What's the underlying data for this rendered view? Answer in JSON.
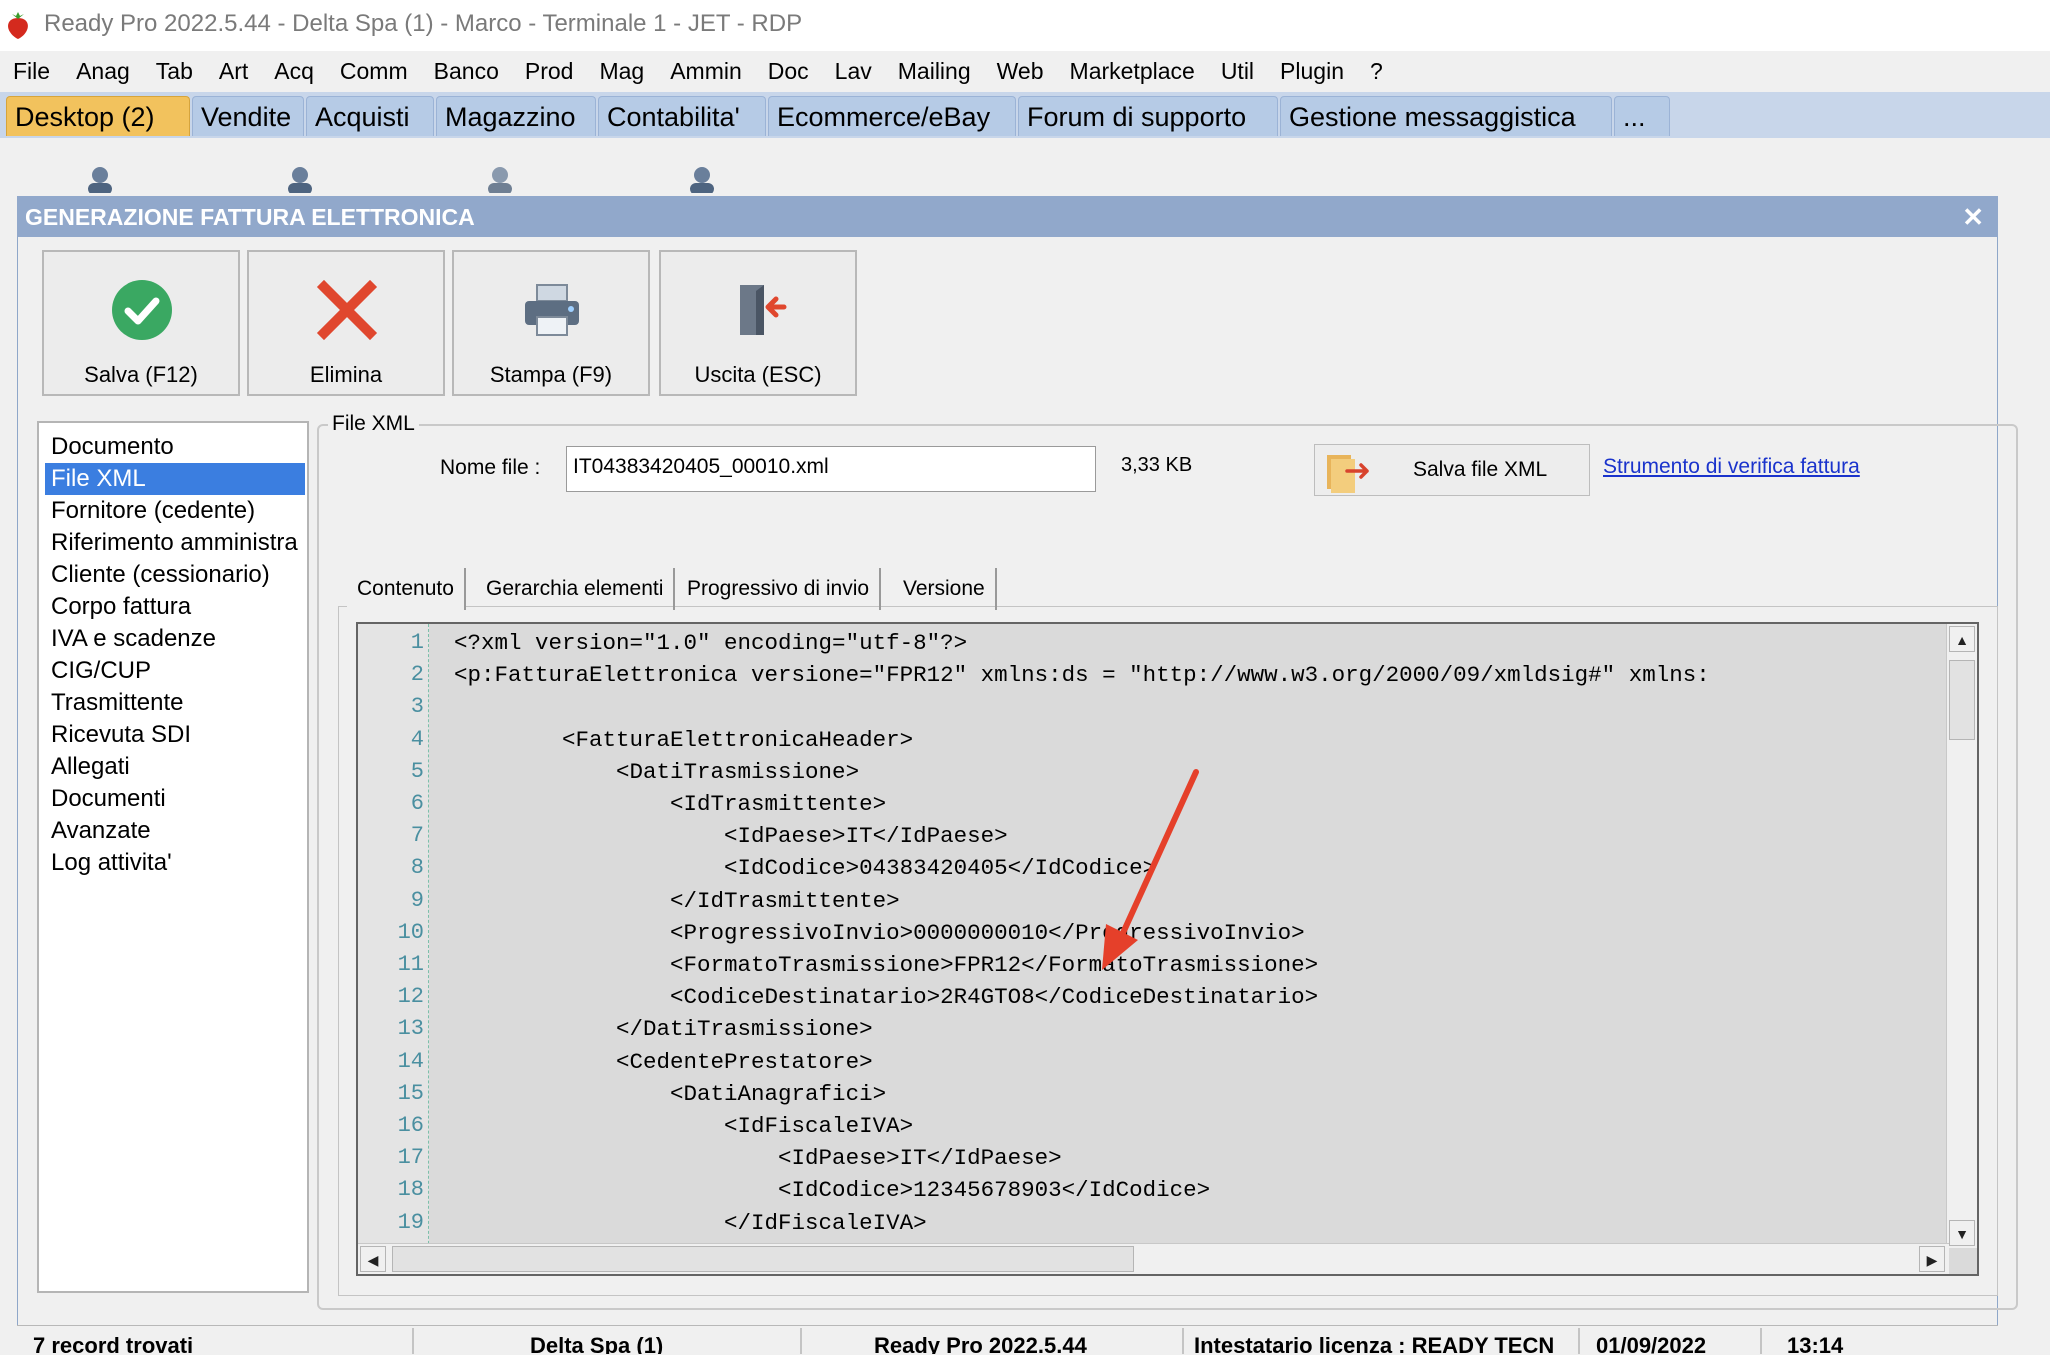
{
  "window": {
    "title": "Ready Pro 2022.5.44 - Delta Spa (1) - Marco - Terminale 1 - JET - RDP"
  },
  "menu": [
    "File",
    "Anag",
    "Tab",
    "Art",
    "Acq",
    "Comm",
    "Banco",
    "Prod",
    "Mag",
    "Ammin",
    "Doc",
    "Lav",
    "Mailing",
    "Web",
    "Marketplace",
    "Util",
    "Plugin",
    "?"
  ],
  "desktop_tabs": [
    "Desktop (2)",
    "Vendite",
    "Acquisti",
    "Magazzino",
    "Contabilita'",
    "Ecommerce/eBay",
    "Forum di supporto",
    "Gestione messaggistica",
    "..."
  ],
  "dialog": {
    "title": "GENERAZIONE FATTURA ELETTRONICA",
    "close_icon": "close-icon",
    "toolbar": {
      "save": "Salva (F12)",
      "delete": "Elimina",
      "print": "Stampa (F9)",
      "exit": "Uscita (ESC)"
    },
    "nav": [
      "Documento",
      "File XML",
      "Fornitore (cedente)",
      "Riferimento amministra",
      "Cliente (cessionario)",
      "Corpo fattura",
      "IVA e scadenze",
      "CIG/CUP",
      "Trasmittente",
      "Ricevuta SDI",
      "Allegati",
      "Documenti",
      "Avanzate",
      "Log attivita'"
    ],
    "nav_selected": "File XML",
    "file_group": {
      "label": "File XML",
      "filename_label": "Nome file :",
      "filename_value": "IT04383420405_00010.xml",
      "size": "3,33 KB",
      "save_xml": "Salva file XML",
      "verify_link": "Strumento di verifica fattura"
    },
    "inner_tabs": [
      "Contenuto",
      "Gerarchia elementi",
      "Progressivo di invio",
      "Versione"
    ],
    "code_lines": [
      {
        "n": "1",
        "t": "<?xml version=\"1.0\" encoding=\"utf-8\"?>"
      },
      {
        "n": "2",
        "t": "<p:FatturaElettronica versione=\"FPR12\" xmlns:ds = \"http://www.w3.org/2000/09/xmldsig#\" xmlns:"
      },
      {
        "n": "3",
        "t": ""
      },
      {
        "n": "4",
        "t": "        <FatturaElettronicaHeader>"
      },
      {
        "n": "5",
        "t": "            <DatiTrasmissione>"
      },
      {
        "n": "6",
        "t": "                <IdTrasmittente>"
      },
      {
        "n": "7",
        "t": "                    <IdPaese>IT</IdPaese>"
      },
      {
        "n": "8",
        "t": "                    <IdCodice>04383420405</IdCodice>"
      },
      {
        "n": "9",
        "t": "                </IdTrasmittente>"
      },
      {
        "n": "10",
        "t": "                <ProgressivoInvio>0000000010</ProgressivoInvio>"
      },
      {
        "n": "11",
        "t": "                <FormatoTrasmissione>FPR12</FormatoTrasmissione>"
      },
      {
        "n": "12",
        "t": "                <CodiceDestinatario>2R4GTO8</CodiceDestinatario>"
      },
      {
        "n": "13",
        "t": "            </DatiTrasmissione>"
      },
      {
        "n": "14",
        "t": "            <CedentePrestatore>"
      },
      {
        "n": "15",
        "t": "                <DatiAnagrafici>"
      },
      {
        "n": "16",
        "t": "                    <IdFiscaleIVA>"
      },
      {
        "n": "17",
        "t": "                        <IdPaese>IT</IdPaese>"
      },
      {
        "n": "18",
        "t": "                        <IdCodice>12345678903</IdCodice>"
      },
      {
        "n": "19",
        "t": "                    </IdFiscaleIVA>"
      }
    ]
  },
  "status": [
    "7 record trovati",
    "Delta Spa (1)",
    "Ready Pro 2022.5.44",
    "Intestatario licenza : READY TECN",
    "01/09/2022",
    "13:14"
  ],
  "colors": {
    "titlebar_bg": "#ffffff",
    "dialog_title_bg": "#91a8cb",
    "active_tab": "#f2c25d",
    "selection": "#3b7ee0",
    "annotation_arrow": "#e5402a"
  }
}
